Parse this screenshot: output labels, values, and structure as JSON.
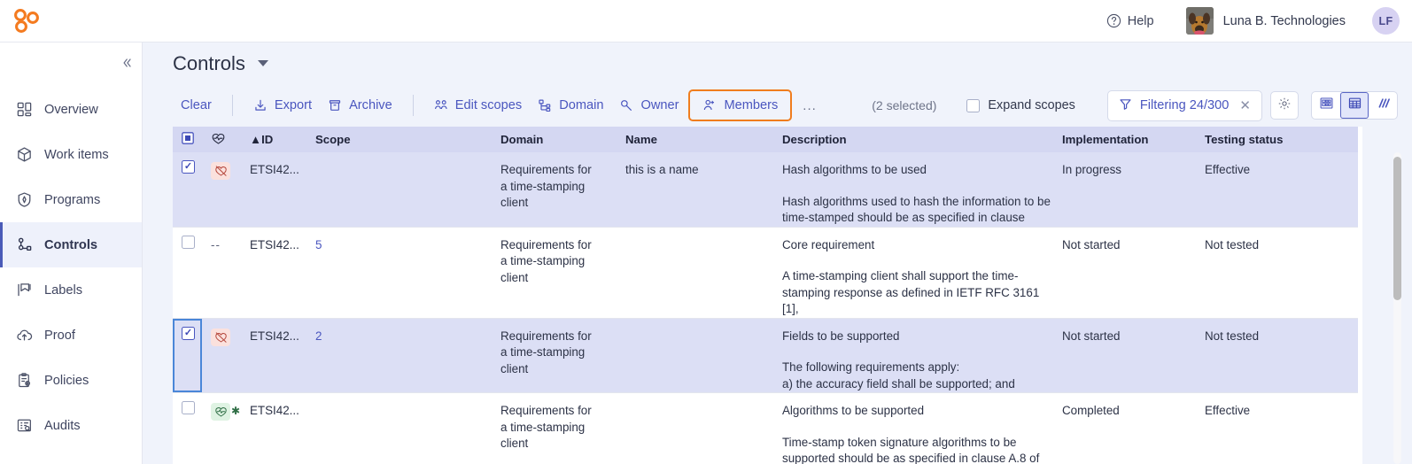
{
  "topbar": {
    "help_label": "Help",
    "help_icon": "question-circle-icon",
    "org_name": "Luna B. Technologies",
    "user_initials": "LF",
    "logo_icon": "three-rings-logo"
  },
  "sidebar": {
    "collapse_icon": "chevron-double-left-icon",
    "items": [
      {
        "label": "Overview",
        "icon": "dashboard-icon",
        "active": false
      },
      {
        "label": "Work items",
        "icon": "box-icon",
        "active": false
      },
      {
        "label": "Programs",
        "icon": "shield-icon",
        "active": false
      },
      {
        "label": "Controls",
        "icon": "hierarchy-icon",
        "active": true
      },
      {
        "label": "Labels",
        "icon": "bookmark-icon",
        "active": false
      },
      {
        "label": "Proof",
        "icon": "cloud-upload-icon",
        "active": false
      },
      {
        "label": "Policies",
        "icon": "clipboard-icon",
        "active": false
      },
      {
        "label": "Audits",
        "icon": "audit-list-icon",
        "active": false
      }
    ]
  },
  "page": {
    "title": "Controls",
    "title_caret_icon": "caret-down-icon"
  },
  "toolbar": {
    "clear_label": "Clear",
    "export_label": "Export",
    "export_icon": "download-icon",
    "archive_label": "Archive",
    "archive_icon": "archive-box-icon",
    "edit_scopes_label": "Edit scopes",
    "edit_scopes_icon": "people-group-icon",
    "domain_label": "Domain",
    "domain_icon": "sitemap-icon",
    "owner_label": "Owner",
    "owner_icon": "key-icon",
    "members_label": "Members",
    "members_icon": "user-add-icon",
    "more_label": "...",
    "selected_count": "(2 selected)",
    "expand_scopes_label": "Expand scopes",
    "expand_scopes_checked": false,
    "filter_label": "Filtering 24/300",
    "filter_icon": "funnel-icon",
    "filter_clear_icon": "close-icon",
    "settings_icon": "gear-icon",
    "highlight_color": "#f07d1e",
    "views": [
      {
        "name": "card-view",
        "icon": "cards-grid-icon",
        "selected": false
      },
      {
        "name": "table-view",
        "icon": "table-grid-icon",
        "selected": true
      },
      {
        "name": "board-view",
        "icon": "diagonal-lines-icon",
        "selected": false
      }
    ]
  },
  "table": {
    "select_all_icon": "partial-select-icon",
    "health_header_icon": "heartbeat-icon",
    "sort_icon": "sort-ascending-icon",
    "columns": [
      "ID",
      "Scope",
      "Domain",
      "Name",
      "Description",
      "Implementation",
      "Testing status"
    ],
    "rows": [
      {
        "checked": true,
        "focused": false,
        "health": "bad",
        "health_icon": "heartbeat-slashed-icon",
        "id": "ETSI42...",
        "scope": "",
        "domain": "Requirements for a time-stamping client",
        "name": "this is a name",
        "desc_title": "Hash algorithms to be used",
        "desc_body": "Hash algorithms used to hash the information to be time-stamped should be as specified in clause",
        "implementation": "In progress",
        "testing_status": "Effective"
      },
      {
        "checked": false,
        "focused": false,
        "health": "none",
        "health_icon": "dash-icon",
        "id": "ETSI42...",
        "scope": "5",
        "domain": "Requirements for a time-stamping client",
        "name": "",
        "desc_title": "Core requirement",
        "desc_body": "A time-stamping client shall support the time-stamping response as defined in IETF RFC 3161 [1],",
        "implementation": "Not started",
        "testing_status": "Not tested"
      },
      {
        "checked": true,
        "focused": true,
        "health": "bad",
        "health_icon": "heartbeat-slashed-icon",
        "id": "ETSI42...",
        "scope": "2",
        "domain": "Requirements for a time-stamping client",
        "name": "",
        "desc_title": "Fields to be supported",
        "desc_body": "The following requirements apply:\na) the accuracy field shall be supported; and",
        "implementation": "Not started",
        "testing_status": "Not tested"
      },
      {
        "checked": false,
        "focused": false,
        "health": "good",
        "health_icon": "heartbeat-star-icon",
        "id": "ETSI42...",
        "scope": "",
        "domain": "Requirements for a time-stamping client",
        "name": "",
        "desc_title": "Algorithms to be supported",
        "desc_body": "Time-stamp token signature algorithms to be supported should be as specified in clause A.8 of",
        "implementation": "Completed",
        "testing_status": "Effective"
      }
    ]
  }
}
